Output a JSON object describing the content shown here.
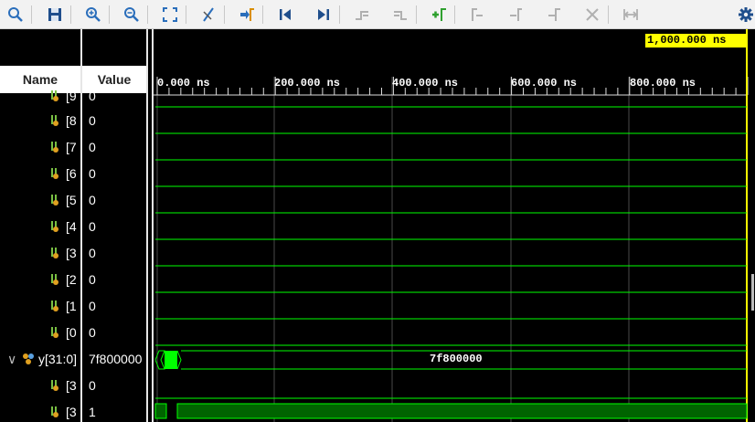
{
  "toolbar": {
    "buttons": [
      "zoom-fit-search",
      "save",
      "zoom-in",
      "zoom-out",
      "zoom-fit",
      "cursor-toggle",
      "go-to-time-0",
      "go-to-start",
      "go-to-end",
      "previous-transition",
      "next-transition",
      "add-marker",
      "previous-marker",
      "next-marker",
      "swap-cursors",
      "clear",
      "snap-to-transition",
      "settings"
    ]
  },
  "headers": {
    "name": "Name",
    "value": "Value"
  },
  "cursor": {
    "time": "1,000.000 ns"
  },
  "timeline": {
    "labels": [
      "0.000 ns",
      "200.000 ns",
      "400.000 ns",
      "600.000 ns",
      "800.000 ns"
    ]
  },
  "signals": [
    {
      "name": "[9",
      "value": "0"
    },
    {
      "name": "[8",
      "value": "0"
    },
    {
      "name": "[7",
      "value": "0"
    },
    {
      "name": "[6",
      "value": "0"
    },
    {
      "name": "[5",
      "value": "0"
    },
    {
      "name": "[4",
      "value": "0"
    },
    {
      "name": "[3",
      "value": "0"
    },
    {
      "name": "[2",
      "value": "0"
    },
    {
      "name": "[1",
      "value": "0"
    },
    {
      "name": "[0",
      "value": "0"
    },
    {
      "name": "y[31:0]",
      "value": "7f800000",
      "bus_label": "7f800000"
    },
    {
      "name": "[3",
      "value": "0"
    },
    {
      "name": "[3",
      "value": "1"
    }
  ],
  "colors": {
    "wave": "#00ff00",
    "grid": "#4a4a4a",
    "cursor": "#ffff00",
    "background": "#000000"
  }
}
